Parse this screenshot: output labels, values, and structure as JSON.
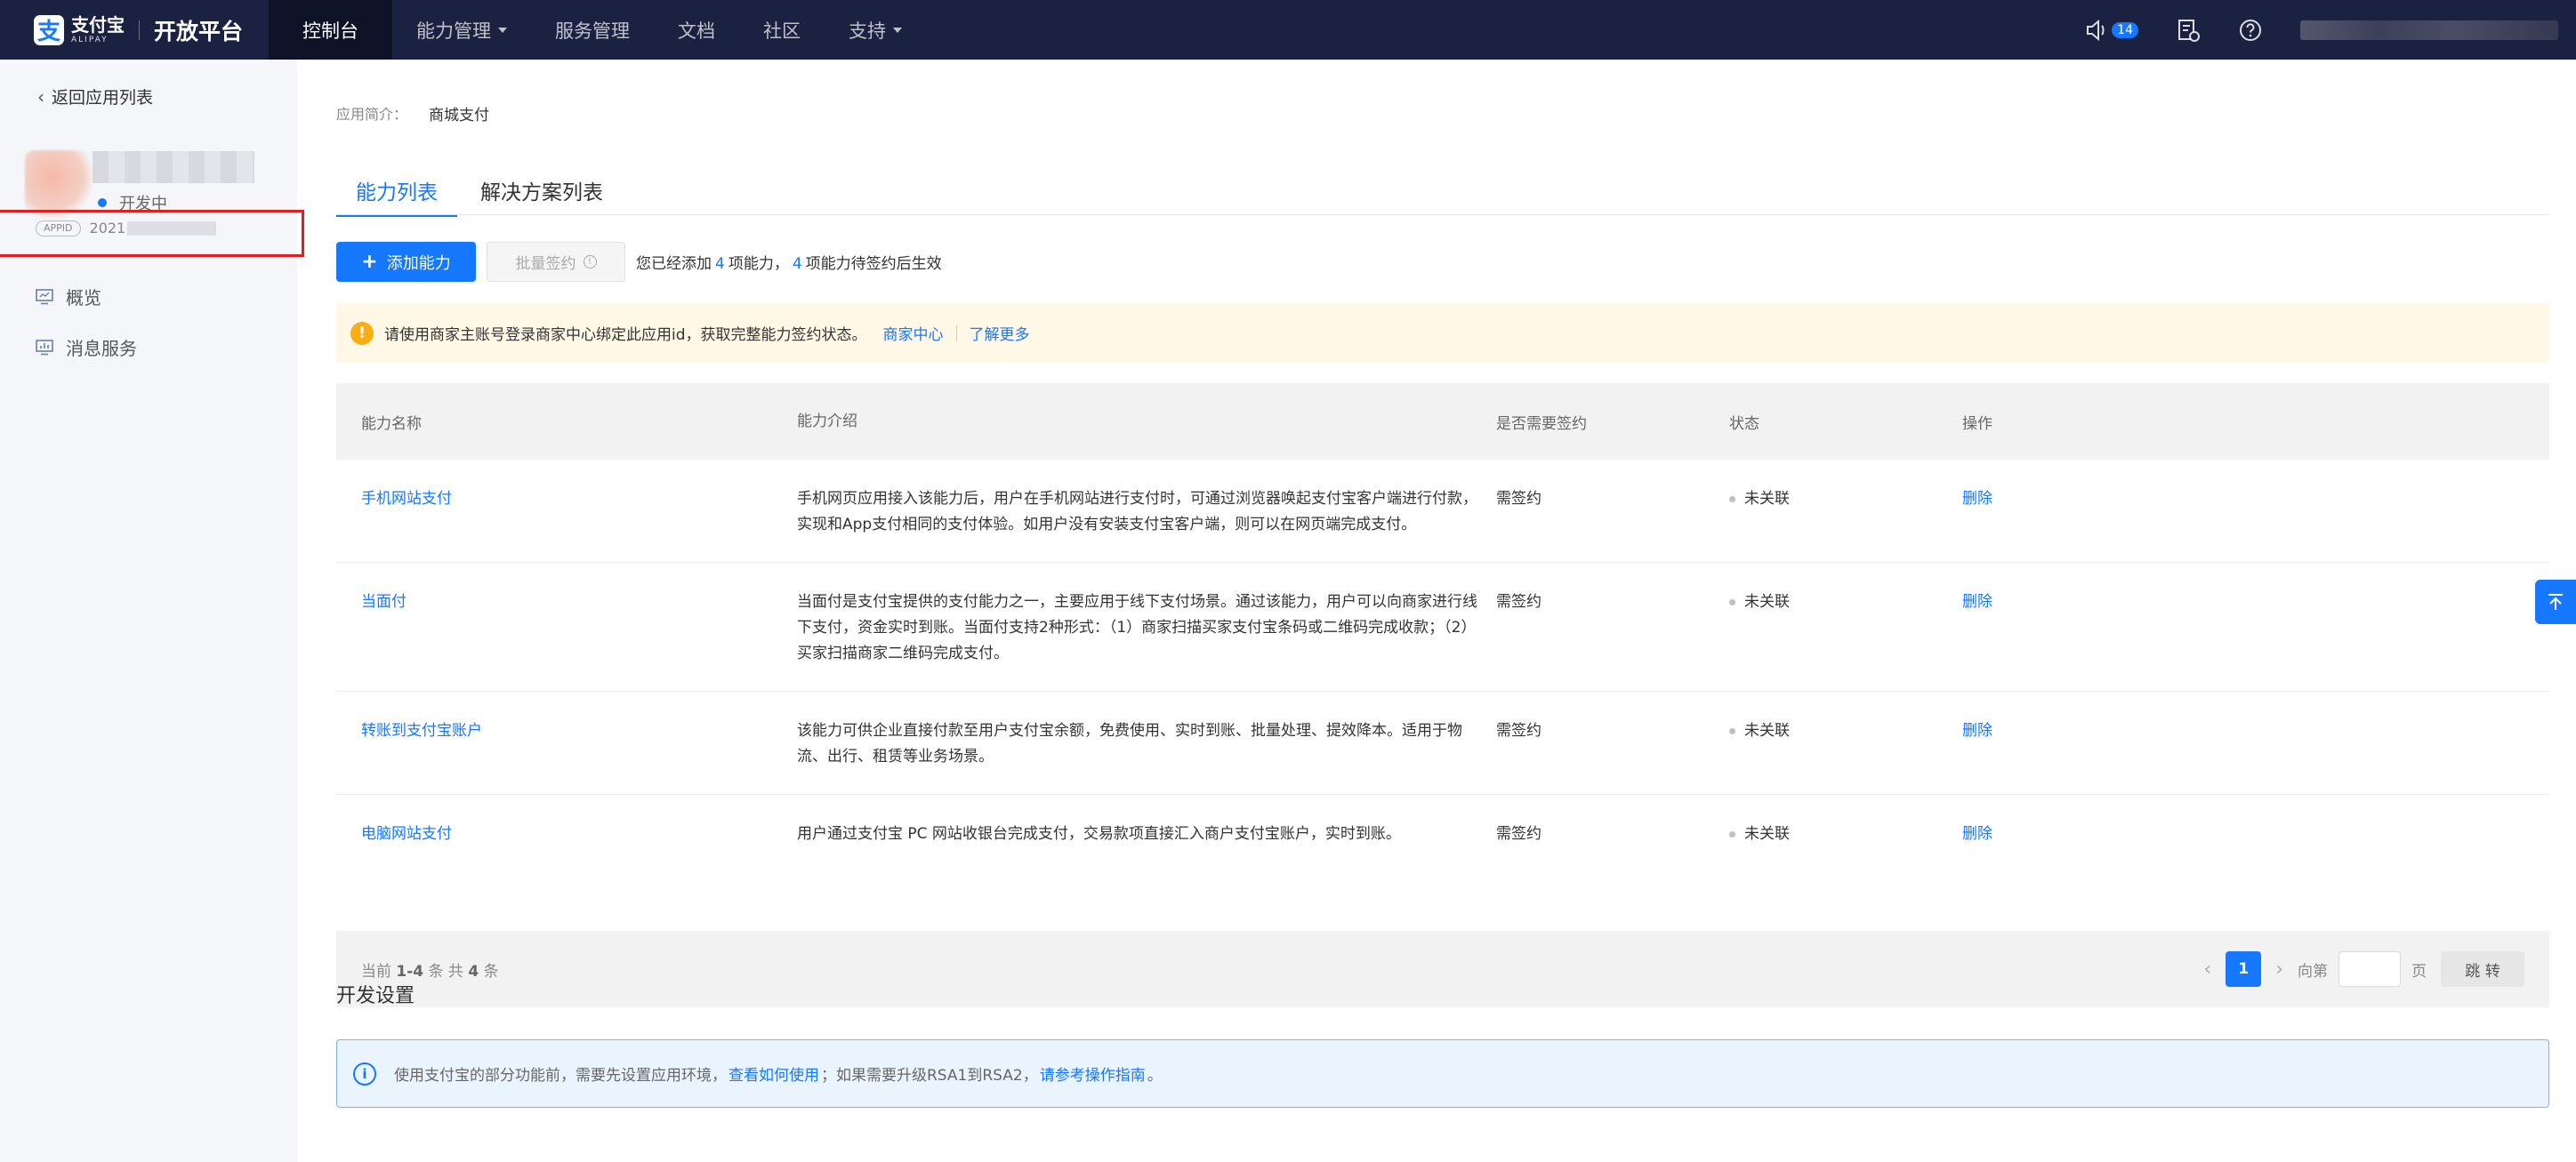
{
  "topbar": {
    "logo_mark": "支",
    "logo_cn": "支付宝",
    "logo_en": "ALIPAY",
    "title": "开放平台",
    "nav": [
      {
        "label": "控制台",
        "active": true,
        "dropdown": false
      },
      {
        "label": "能力管理",
        "active": false,
        "dropdown": true
      },
      {
        "label": "服务管理",
        "active": false,
        "dropdown": false
      },
      {
        "label": "文档",
        "active": false,
        "dropdown": false
      },
      {
        "label": "社区",
        "active": false,
        "dropdown": false
      },
      {
        "label": "支持",
        "active": false,
        "dropdown": true
      }
    ],
    "notification_count": "14"
  },
  "sidebar": {
    "back_label": "返回应用列表",
    "status": "开发中",
    "appid_tag": "APPID",
    "appid_prefix": "2021",
    "menu": [
      {
        "label": "概览",
        "icon": "monitor-icon"
      },
      {
        "label": "消息服务",
        "icon": "message-chart-icon"
      }
    ]
  },
  "main": {
    "intro_label": "应用简介：",
    "intro_value": "商城支付",
    "tabs": [
      {
        "label": "能力列表",
        "active": true
      },
      {
        "label": "解决方案列表",
        "active": false
      }
    ],
    "add_button": "添加能力",
    "batch_button": "批量签约",
    "summary": {
      "prefix": "您已经添加",
      "added": "4",
      "mid": "项能力，",
      "pending": "4",
      "suffix": "项能力待签约后生效"
    },
    "warning": {
      "text": "请使用商家主账号登录商家中心绑定此应用id，获取完整能力签约状态。",
      "link1": "商家中心",
      "link2": "了解更多"
    },
    "table": {
      "headers": [
        "能力名称",
        "能力介绍",
        "是否需要签约",
        "状态",
        "操作"
      ],
      "rows": [
        {
          "name": "手机网站支付",
          "desc": "手机网页应用接入该能力后，用户在手机网站进行支付时，可通过浏览器唤起支付宝客户端进行付款，实现和App支付相同的支付体验。如用户没有安装支付宝客户端，则可以在网页端完成支付。",
          "sign": "需签约",
          "status": "未关联",
          "action": "删除"
        },
        {
          "name": "当面付",
          "desc": "当面付是支付宝提供的支付能力之一，主要应用于线下支付场景。通过该能力，用户可以向商家进行线下支付，资金实时到账。当面付支持2种形式：（1）商家扫描买家支付宝条码或二维码完成收款；（2）买家扫描商家二维码完成支付。",
          "sign": "需签约",
          "status": "未关联",
          "action": "删除"
        },
        {
          "name": "转账到支付宝账户",
          "desc": "该能力可供企业直接付款至用户支付宝余额，免费使用、实时到账、批量处理、提效降本。适用于物流、出行、租赁等业务场景。",
          "sign": "需签约",
          "status": "未关联",
          "action": "删除"
        },
        {
          "name": "电脑网站支付",
          "desc": "用户通过支付宝 PC 网站收银台完成支付，交易款项直接汇入商户支付宝账户，实时到账。",
          "sign": "需签约",
          "status": "未关联",
          "action": "删除"
        }
      ]
    },
    "pager": {
      "total_prefix": "当前",
      "range": "1-4",
      "total_mid": "条 共",
      "total": "4",
      "total_suffix": "条",
      "current_page": "1",
      "jump_prefix": "向第",
      "jump_suffix": "页",
      "jump_button": "跳 转"
    },
    "dev_settings": {
      "title": "开发设置",
      "text1": "使用支付宝的部分功能前，需要先设置应用环境，",
      "link1": "查看如何使用",
      "text2": "；如果需要升级RSA1到RSA2，",
      "link2": "请参考操作指南",
      "text3": "。"
    }
  },
  "colors": {
    "topbar": "#1b2140",
    "primary": "#1677ff",
    "warning_bg": "#fff8e6",
    "highlight_box": "#e02020"
  }
}
